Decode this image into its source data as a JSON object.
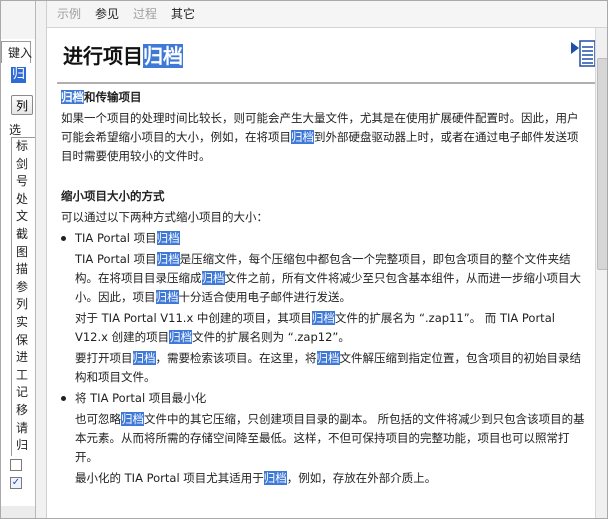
{
  "menu": {
    "items": [
      {
        "label": "示例",
        "enabled": false
      },
      {
        "label": "参见",
        "enabled": true
      },
      {
        "label": "过程",
        "enabled": false
      },
      {
        "label": "其它",
        "enabled": true
      }
    ]
  },
  "left_nav": {
    "tab_label": "键入",
    "keyword": "归",
    "show_button": "列",
    "select_label": "选",
    "topics": [
      "标",
      "剑",
      "号",
      "处",
      "文",
      "截",
      "图",
      "描",
      "参",
      "列",
      "实",
      "保",
      "进",
      "工",
      "记",
      "移",
      "请",
      "归"
    ],
    "checkboxes": [
      {
        "checked": false
      },
      {
        "checked": true
      }
    ]
  },
  "article": {
    "title_prefix": "进行项目",
    "title_highlight": "归档",
    "sec1_heading_hl": "归档",
    "sec1_heading_rest": "和传输项目",
    "sec1_p1": "如果一个项目的处理时间比较长，则可能会产生大量文件，尤其是在使用扩展硬件配置时。因此，用户可能会希望缩小项目的大小，例如，在将项目",
    "sec1_p1_hl": "归档",
    "sec1_p1_end": "到外部硬盘驱动器上时，或者在通过电子邮件发送项目时需要使用较小的文件时。",
    "sec2_heading": "缩小项目大小的方式",
    "sec2_intro": "可以通过以下两种方式缩小项目的大小：",
    "b1_title_a": "TIA Portal 项目",
    "b1_title_hl": "归档",
    "b1_p1_a": "TIA Portal 项目",
    "b1_p1_hl1": "归档",
    "b1_p1_b": "是压缩文件，每个压缩包中都包含一个完整项目，即包含项目的整个文件夹结构。在将项目目录压缩成",
    "b1_p1_hl2": "归档",
    "b1_p1_c": "文件之前，所有文件将减少至只包含基本组件，从而进一步缩小项目大小。因此，项目",
    "b1_p1_hl3": "归档",
    "b1_p1_d": "十分适合使用电子邮件进行发送。",
    "b1_p2_a": "对于 TIA Portal V11.x 中创建的项目，其项目",
    "b1_p2_hl1": "归档",
    "b1_p2_b": "文件的扩展名为 “.zap11”。 而 TIA Portal V12.x 创建的项目",
    "b1_p2_hl2": "归档",
    "b1_p2_c": "文件的扩展名则为 “.zap12”。",
    "b1_p3_a": "要打开项目",
    "b1_p3_hl1": "归档",
    "b1_p3_b": "，需要检索该项目。在这里，将",
    "b1_p3_hl2": "归档",
    "b1_p3_c": "文件解压缩到指定位置，包含项目的初始目录结构和项目文件。",
    "b2_title": "将 TIA Portal 项目最小化",
    "b2_p1_a": "也可忽略",
    "b2_p1_hl": "归档",
    "b2_p1_b": "文件中的其它压缩，只创建项目目录的副本。 所包括的文件将减少到只包含该项目的基本元素。从而将所需的存储空间降至最低。这样，不但可保持项目的完整功能，项目也可以照常打开。",
    "b2_p2_a": "最小化的 TIA Portal 项目尤其适用于",
    "b2_p2_hl": "归档",
    "b2_p2_b": "，例如，存放在外部介质上。"
  },
  "colors": {
    "highlight": "#3f79d8",
    "nav_icon": "#1f4fa8"
  }
}
